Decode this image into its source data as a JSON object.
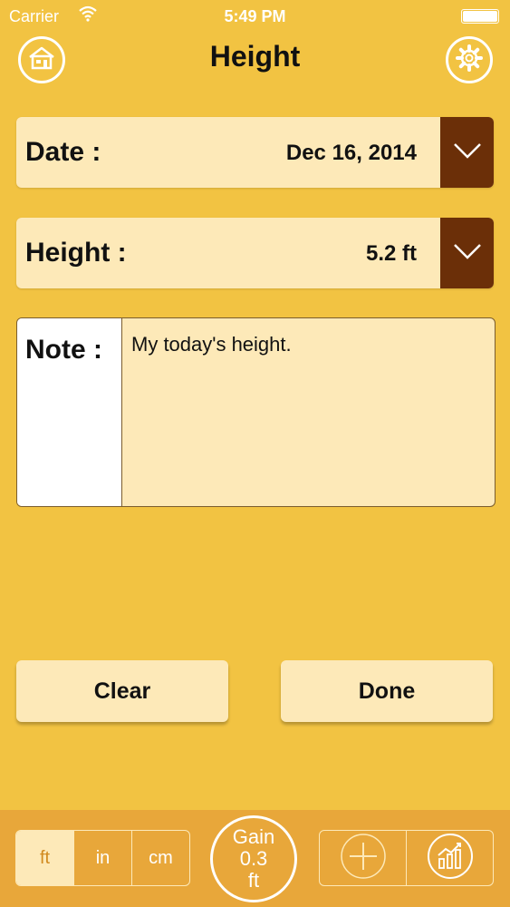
{
  "status_bar": {
    "carrier": "Carrier",
    "time": "5:49 PM"
  },
  "header": {
    "title": "Height"
  },
  "date_field": {
    "label": "Date :",
    "value": "Dec 16, 2014"
  },
  "height_field": {
    "label": "Height :",
    "value": "5.2 ft"
  },
  "note": {
    "label": "Note :",
    "value": "My today's height."
  },
  "actions": {
    "clear_label": "Clear",
    "done_label": "Done"
  },
  "units": {
    "ft": "ft",
    "in": "in",
    "cm": "cm",
    "selected": "ft"
  },
  "gain": {
    "label": "Gain",
    "value": "0.3",
    "unit": "ft"
  },
  "icons": {
    "home": "home-icon",
    "settings": "gear-icon",
    "dropdown": "chevron-down-icon",
    "add": "plus-icon",
    "chart": "chart-icon",
    "wifi": "wifi-icon"
  },
  "colors": {
    "background": "#f2c342",
    "field": "#fde9b8",
    "dropdown": "#6b2f08",
    "bottom_bar": "#e8a73a"
  }
}
